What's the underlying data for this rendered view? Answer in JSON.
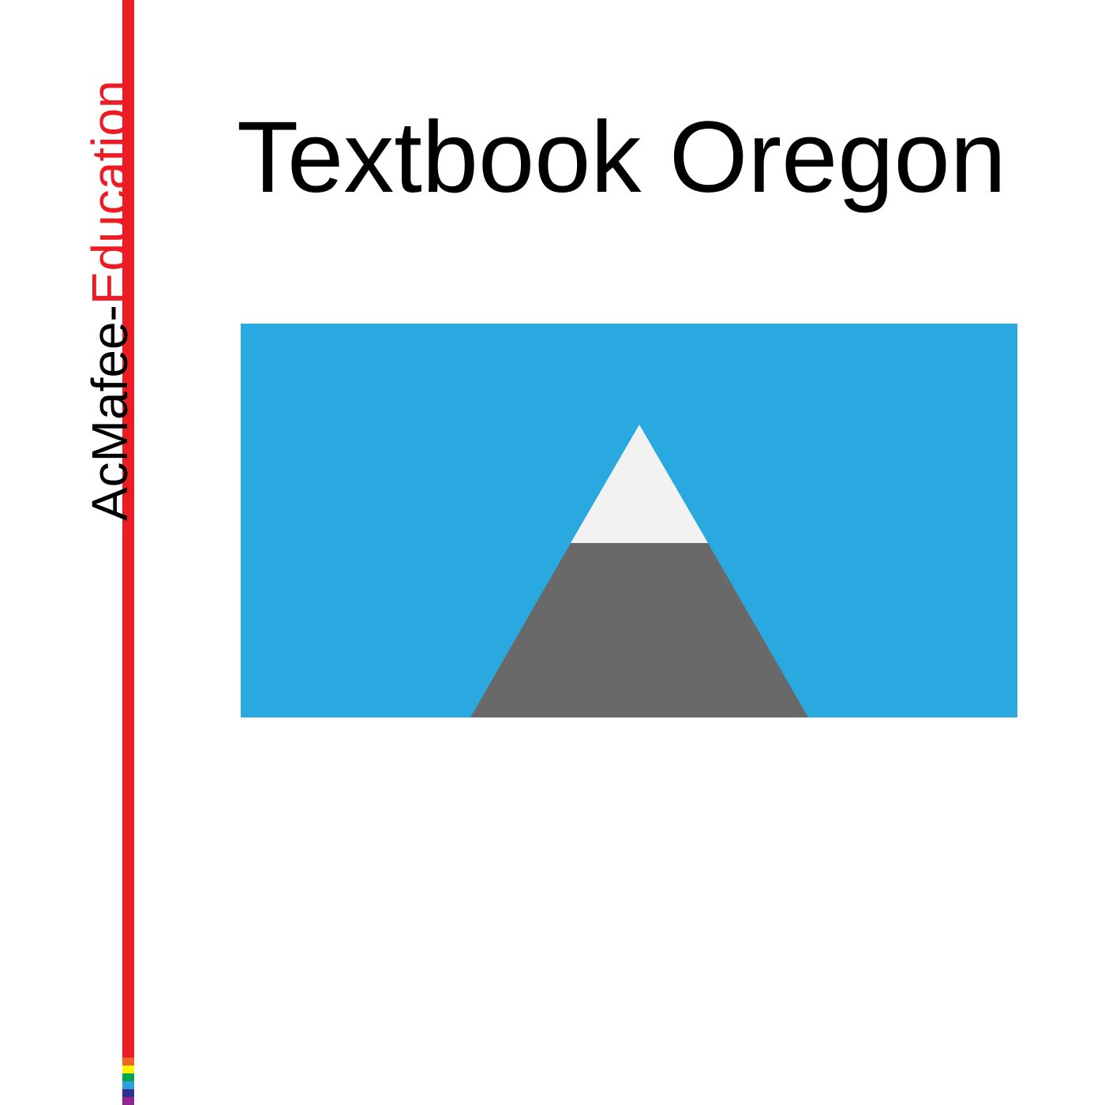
{
  "publisher": {
    "prefix": "AcMafee-",
    "suffix": "Education",
    "prefix_color": "#000000",
    "suffix_color": "#ed1c24"
  },
  "title": "Textbook Oregon",
  "illustration": {
    "subject": "mountain-icon",
    "sky_color": "#2aa9e0",
    "snowcap_color": "#f2f2f2",
    "mountain_color": "#696969"
  },
  "rule": {
    "main_color": "#ed1c24",
    "stripe_colors": [
      "#f26522",
      "#fff200",
      "#00a651",
      "#2e9fd9",
      "#2e3192",
      "#92278f"
    ]
  }
}
